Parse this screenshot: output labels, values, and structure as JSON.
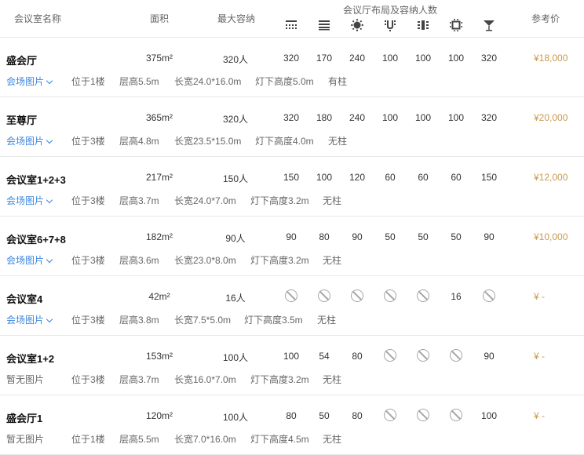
{
  "header": {
    "col_name": "会议室名称",
    "col_area": "面积",
    "col_capacity": "最大容纳",
    "col_layouts": "会议厅布局及容纳人数",
    "col_price": "参考价",
    "layout_icons": [
      "theater-layout-icon",
      "classroom-layout-icon",
      "banquet-layout-icon",
      "u-shape-layout-icon",
      "boardroom-layout-icon",
      "hollow-square-layout-icon",
      "cocktail-layout-icon"
    ]
  },
  "rooms": [
    {
      "name": "盛会厅",
      "area": "375m²",
      "capacity": "320人",
      "layouts": [
        "320",
        "170",
        "240",
        "100",
        "100",
        "100",
        "320"
      ],
      "price": "¥18,000",
      "photos": "会场图片",
      "floor": "位于1楼",
      "height": "层高5.5m",
      "size": "长宽24.0*16.0m",
      "light": "灯下高度5.0m",
      "pillar": "有柱"
    },
    {
      "name": "至尊厅",
      "area": "365m²",
      "capacity": "320人",
      "layouts": [
        "320",
        "180",
        "240",
        "100",
        "100",
        "100",
        "320"
      ],
      "price": "¥20,000",
      "photos": "会场图片",
      "floor": "位于3楼",
      "height": "层高4.8m",
      "size": "长宽23.5*15.0m",
      "light": "灯下高度4.0m",
      "pillar": "无柱"
    },
    {
      "name": "会议室1+2+3",
      "area": "217m²",
      "capacity": "150人",
      "layouts": [
        "150",
        "100",
        "120",
        "60",
        "60",
        "60",
        "150"
      ],
      "price": "¥12,000",
      "photos": "会场图片",
      "floor": "位于3楼",
      "height": "层高3.7m",
      "size": "长宽24.0*7.0m",
      "light": "灯下高度3.2m",
      "pillar": "无柱"
    },
    {
      "name": "会议室6+7+8",
      "area": "182m²",
      "capacity": "90人",
      "layouts": [
        "90",
        "80",
        "90",
        "50",
        "50",
        "50",
        "90"
      ],
      "price": "¥10,000",
      "photos": "会场图片",
      "floor": "位于3楼",
      "height": "层高3.6m",
      "size": "长宽23.0*8.0m",
      "light": "灯下高度3.2m",
      "pillar": "无柱"
    },
    {
      "name": "会议室4",
      "area": "42m²",
      "capacity": "16人",
      "layouts": [
        null,
        null,
        null,
        null,
        null,
        "16",
        null
      ],
      "price": "¥ -",
      "photos": "会场图片",
      "floor": "位于3楼",
      "height": "层高3.8m",
      "size": "长宽7.5*5.0m",
      "light": "灯下高度3.5m",
      "pillar": "无柱"
    },
    {
      "name": "会议室1+2",
      "area": "153m²",
      "capacity": "100人",
      "layouts": [
        "100",
        "54",
        "80",
        null,
        null,
        null,
        "90"
      ],
      "price": "¥ -",
      "photos": "暂无图片",
      "floor": "位于3楼",
      "height": "层高3.7m",
      "size": "长宽16.0*7.0m",
      "light": "灯下高度3.2m",
      "pillar": "无柱"
    },
    {
      "name": "盛会厅1",
      "area": "120m²",
      "capacity": "100人",
      "layouts": [
        "80",
        "50",
        "80",
        null,
        null,
        null,
        "100"
      ],
      "price": "¥ -",
      "photos": "暂无图片",
      "floor": "位于1楼",
      "height": "层高5.5m",
      "size": "长宽7.0*16.0m",
      "light": "灯下高度4.5m",
      "pillar": "无柱"
    }
  ]
}
